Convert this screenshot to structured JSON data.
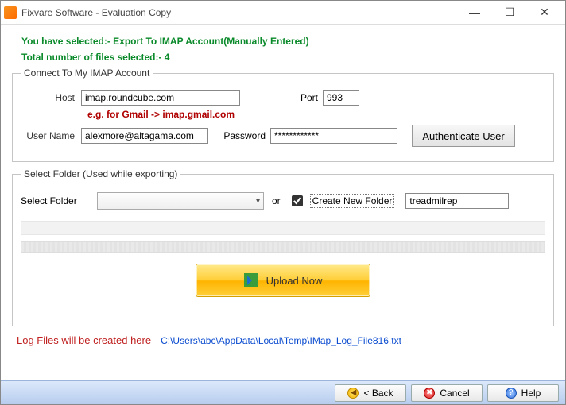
{
  "window": {
    "title": "Fixvare Software - Evaluation Copy"
  },
  "info": {
    "selected_line": "You have selected:- Export To IMAP Account(Manually Entered)",
    "total_files_line": "Total number of files selected:- 4"
  },
  "imap": {
    "legend": "Connect To My IMAP Account",
    "host_label": "Host",
    "host_value": "imap.roundcube.com",
    "port_label": "Port",
    "port_value": "993",
    "hint": "e.g. for Gmail -> imap.gmail.com",
    "user_label": "User Name",
    "user_value": "alexmore@altagama.com",
    "pass_label": "Password",
    "pass_value": "************",
    "auth_label": "Authenticate User"
  },
  "folder": {
    "legend": "Select Folder (Used while exporting)",
    "select_label": "Select Folder",
    "or_label": "or",
    "create_label": "Create New Folder",
    "create_checked": true,
    "new_folder_value": "treadmilrep"
  },
  "upload": {
    "label": "Upload Now"
  },
  "log": {
    "label": "Log Files will be created here",
    "link": "C:\\Users\\abc\\AppData\\Local\\Temp\\IMap_Log_File816.txt"
  },
  "footer": {
    "back": "< Back",
    "cancel": "Cancel",
    "help": "Help"
  }
}
